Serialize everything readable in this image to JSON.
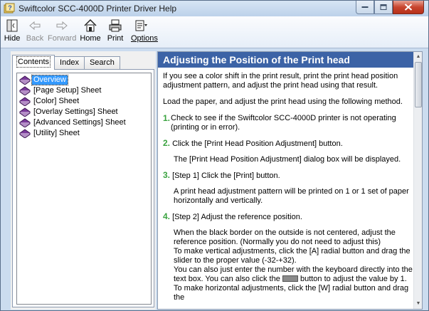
{
  "window": {
    "title": "Swiftcolor SCC-4000D Printer Driver Help",
    "caption_icons": [
      "minimize-icon",
      "maximize-icon",
      "close-icon"
    ]
  },
  "toolbar": {
    "hide": "Hide",
    "back": "Back",
    "forward": "Forward",
    "home": "Home",
    "print": "Print",
    "options": "Options"
  },
  "tabs": {
    "contents": "Contents",
    "index": "Index",
    "search": "Search",
    "active": "Contents"
  },
  "tree": {
    "items": [
      {
        "label": "Overview",
        "selected": true
      },
      {
        "label": "[Page Setup] Sheet",
        "selected": false
      },
      {
        "label": "[Color] Sheet",
        "selected": false
      },
      {
        "label": "[Overlay Settings] Sheet",
        "selected": false
      },
      {
        "label": "[Advanced Settings] Sheet",
        "selected": false
      },
      {
        "label": "[Utility] Sheet",
        "selected": false
      }
    ]
  },
  "content": {
    "heading": "Adjusting the Position of the Print head",
    "intro": "If you see a color shift in the print result, print the print head position adjustment pattern, and adjust the print head using that result.",
    "load": "Load the paper, and adjust the print head using the following method.",
    "steps": [
      {
        "num": "1.",
        "text": "Check to see if the Swiftcolor SCC-4000D printer is not operating (printing or in error).",
        "detail": ""
      },
      {
        "num": "2.",
        "text": "Click the [Print Head Position Adjustment] button.",
        "detail": "The [Print Head Position Adjustment] dialog box will be displayed."
      },
      {
        "num": "3.",
        "text": "[Step 1] Click the [Print] button.",
        "detail": "A print head adjustment pattern will be printed on 1 or 1 set of paper horizontally and vertically."
      },
      {
        "num": "4.",
        "text": "[Step 2] Adjust the reference position.",
        "detail": ""
      }
    ],
    "step4_lines": [
      "When the black border on the outside is not centered, adjust the reference position. (Normally you do not need to adjust this)",
      "To make vertical adjustments, click the [A] radial button and drag the slider to the proper value (-32-+32).",
      "You can also just enter the number with the keyboard directly into the text box. You can also click the",
      "button to adjust the value by 1.",
      "To make horizontal adjustments, click the [W] radial button and drag the"
    ]
  },
  "colors": {
    "header_bg": "#3c63a6",
    "step_number": "#3aa340",
    "selection": "#3399ff"
  }
}
